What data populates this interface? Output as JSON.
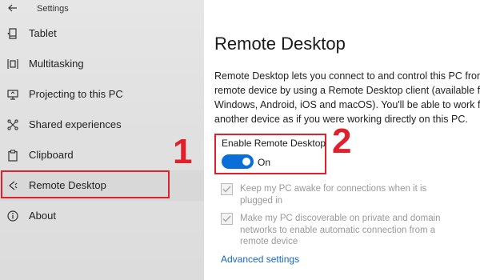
{
  "window": {
    "title": "Settings"
  },
  "sidebar": {
    "items": [
      {
        "label": "Tablet",
        "icon": "tablet-icon"
      },
      {
        "label": "Multitasking",
        "icon": "multitasking-icon"
      },
      {
        "label": "Projecting to this PC",
        "icon": "projecting-icon"
      },
      {
        "label": "Shared experiences",
        "icon": "shared-experiences-icon"
      },
      {
        "label": "Clipboard",
        "icon": "clipboard-icon"
      },
      {
        "label": "Remote Desktop",
        "icon": "remote-desktop-icon",
        "selected": true
      },
      {
        "label": "About",
        "icon": "info-icon"
      }
    ]
  },
  "main": {
    "title": "Remote Desktop",
    "description_lines": [
      "Remote Desktop lets you connect to and control this PC from a",
      "remote device by using a Remote Desktop client (available for",
      "Windows, Android, iOS and macOS). You'll be able to work from",
      "another device as if you were working directly on this PC."
    ],
    "enable_label": "Enable Remote Desktop",
    "toggle_state": "On",
    "toggle_on": true,
    "options": [
      {
        "lines": [
          "Keep my PC awake for connections when it is",
          "plugged in"
        ],
        "checked": true,
        "disabled": true
      },
      {
        "lines": [
          "Make my PC discoverable on private and domain",
          "networks to enable automatic connection from a",
          "remote device"
        ],
        "checked": true,
        "disabled": true
      }
    ],
    "advanced_link": "Advanced settings"
  },
  "annotations": {
    "callout_1": "1",
    "callout_2": "2"
  },
  "colors": {
    "accent": "#0a6fd8",
    "annotation": "#e0202a",
    "link": "#1666c2"
  }
}
